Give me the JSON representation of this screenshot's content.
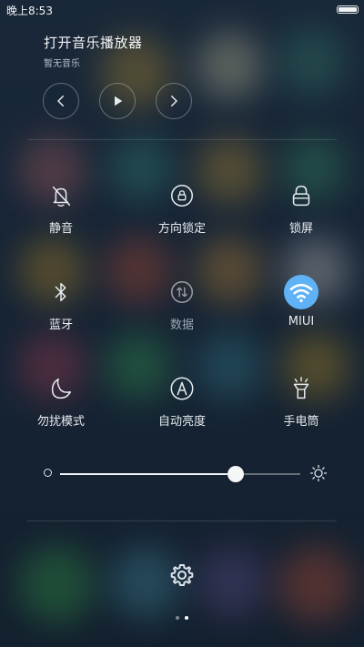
{
  "status_bar": {
    "time": "晚上8:53",
    "battery_level": 1.0
  },
  "music": {
    "title": "打开音乐播放器",
    "subtitle": "暂无音乐"
  },
  "tiles": {
    "mute": {
      "label": "静音",
      "icon": "bell-off-icon"
    },
    "rotation_lock": {
      "label": "方向锁定",
      "icon": "rotation-lock-icon"
    },
    "lock_screen": {
      "label": "锁屏",
      "icon": "lock-icon"
    },
    "bluetooth": {
      "label": "蓝牙",
      "icon": "bluetooth-icon"
    },
    "data": {
      "label": "数据",
      "icon": "mobile-data-icon",
      "enabled": false
    },
    "wifi": {
      "label": "MIUI",
      "icon": "wifi-icon",
      "active": true
    },
    "dnd": {
      "label": "勿扰模式",
      "icon": "moon-icon"
    },
    "auto_brightness": {
      "label": "自动亮度",
      "icon": "auto-brightness-icon"
    },
    "flashlight": {
      "label": "手电筒",
      "icon": "flashlight-icon"
    }
  },
  "brightness": {
    "level": 0.73
  },
  "pager": {
    "pages": 2,
    "current": 2
  },
  "colors": {
    "accent": "#5fb2f6"
  }
}
